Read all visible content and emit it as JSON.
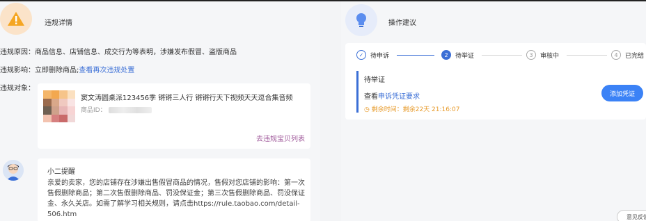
{
  "violation": {
    "title": "违规详情",
    "reason_label": "违规原因：",
    "reason_text": "商品信息、店铺信息、成交行为等表明，涉嫌发布假冒、盗版商品",
    "impact_label": "违规影响：",
    "impact_text": "立即删除商品;",
    "impact_link": "查看再次违规处置",
    "object_label": "违规对象：",
    "product_title": "窦文涛圆桌派123456季 锵锵三人行 锵锵行天下视频天天逗合集音频",
    "product_id_label": "商品ID：",
    "product_list_link": "去违规宝贝列表"
  },
  "message": {
    "title": "小二提醒",
    "body": "亲爱的卖家，您的店铺存在涉嫌出售假冒商品的情况，售假对您店铺的影响：第一次售假删除商品；第二次售假删除商品、罚没保证金；第三次售假删除商品、罚没保证金、永久关店。如需了解学习相关规则，请点击https://rule.taobao.com/detail-506.htm"
  },
  "suggestion": {
    "title": "操作建议",
    "steps": [
      {
        "num": "✓",
        "label": "待申诉"
      },
      {
        "num": "2",
        "label": "待举证"
      },
      {
        "num": "3",
        "label": "审核中"
      },
      {
        "num": "4",
        "label": "已完结"
      }
    ],
    "status_title": "待举证",
    "status_prefix": "查看",
    "status_link": "申诉凭证要求",
    "remaining": "剩余时间：剩余22天 21:16:07",
    "add_button": "添加凭证",
    "feedback_button": "意见反馈"
  },
  "colors": {
    "accent": "#3b6fd6",
    "button": "#3b82f6",
    "warning": "#e79a2a"
  }
}
